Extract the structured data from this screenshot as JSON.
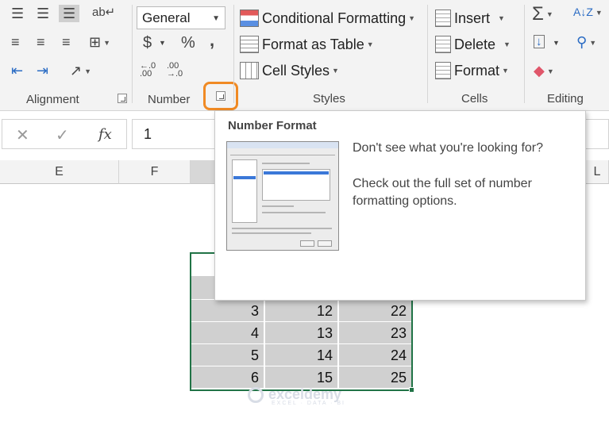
{
  "ribbon": {
    "alignment": {
      "label": "Alignment"
    },
    "number": {
      "label": "Number",
      "format_value": "General",
      "currency_symbol": "$",
      "percent_symbol": "%",
      "comma_symbol": ","
    },
    "styles": {
      "label": "Styles",
      "conditional_formatting": "Conditional Formatting",
      "format_as_table": "Format as Table",
      "cell_styles": "Cell Styles"
    },
    "cells": {
      "label": "Cells",
      "insert": "Insert",
      "delete": "Delete",
      "format": "Format"
    },
    "editing": {
      "label": "Editing"
    }
  },
  "formula_bar": {
    "fx": "fx",
    "value": "1"
  },
  "columns": [
    "E",
    "F",
    "L"
  ],
  "tooltip": {
    "title": "Number Format",
    "line1": "Don't see what you're looking for?",
    "line2": "Check out the full set of number formatting options."
  },
  "grid": {
    "rows": [
      [
        "3",
        "12",
        "22"
      ],
      [
        "4",
        "13",
        "23"
      ],
      [
        "5",
        "14",
        "24"
      ],
      [
        "6",
        "15",
        "25"
      ]
    ]
  },
  "watermark": {
    "name": "exceldemy",
    "tagline": "EXCEL · DATA · BI"
  },
  "colors": {
    "accent_highlight": "#f08a24",
    "selection_border": "#217346",
    "selected_cell_fill": "#d0d0d0"
  }
}
